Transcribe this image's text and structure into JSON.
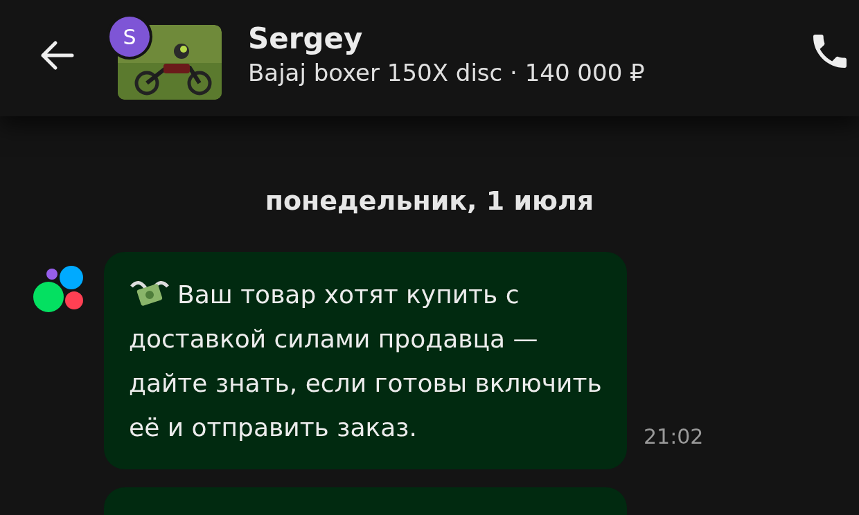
{
  "header": {
    "avatar_letter": "S",
    "name": "Sergey",
    "listing": "Bajaj boxer 150X disc",
    "price": "· 140 000 ₽"
  },
  "date_divider": "понедельник, 1 июля",
  "messages": [
    {
      "kind": "system",
      "text": "Ваш товар хотят купить с доставкой силами продавца — дайте знать, если готовы включить её и отправить заказ.",
      "time": "21:02"
    }
  ]
}
